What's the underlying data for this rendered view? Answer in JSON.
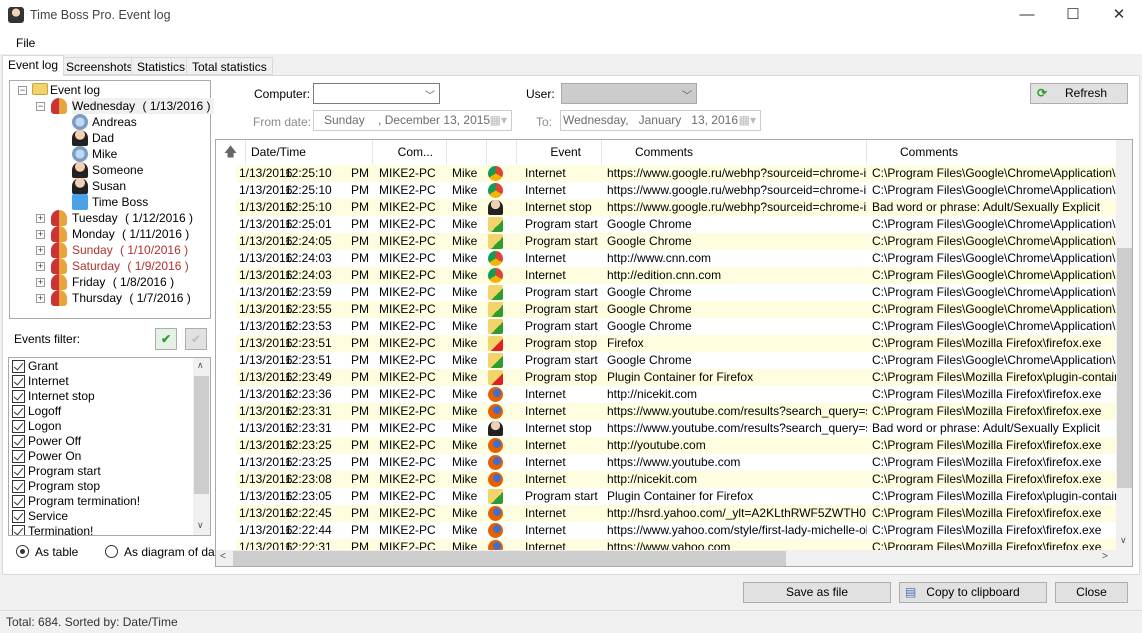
{
  "window": {
    "title": "Time Boss Pro. Event log",
    "minimize": "—",
    "maximize": "☐",
    "close": "✕"
  },
  "menu": {
    "file": "File"
  },
  "tabs": [
    {
      "label": "Event log",
      "active": true
    },
    {
      "label": "Screenshots"
    },
    {
      "label": "Statistics"
    },
    {
      "label": "Total statistics"
    }
  ],
  "tree": {
    "root": "Event log",
    "days": [
      {
        "day": "Wednesday",
        "date": "( 1/13/2016 )",
        "expanded": true,
        "weekend": false,
        "users": [
          {
            "name": "Andreas",
            "icon": "standard-user-icon"
          },
          {
            "name": "Dad",
            "icon": "admin-user-icon"
          },
          {
            "name": "Mike",
            "icon": "standard-user-icon"
          },
          {
            "name": "Someone",
            "icon": "admin-user-icon"
          },
          {
            "name": "Susan",
            "icon": "admin-user-icon"
          },
          {
            "name": "Time Boss",
            "icon": "computer-icon"
          }
        ]
      },
      {
        "day": "Tuesday",
        "date": "( 1/12/2016 )",
        "weekend": false
      },
      {
        "day": "Monday",
        "date": "( 1/11/2016 )",
        "weekend": false
      },
      {
        "day": "Sunday",
        "date": "( 1/10/2016 )",
        "weekend": true
      },
      {
        "day": "Saturday",
        "date": "( 1/9/2016 )",
        "weekend": true
      },
      {
        "day": "Friday",
        "date": "( 1/8/2016 )",
        "weekend": false
      },
      {
        "day": "Thursday",
        "date": "( 1/7/2016 )",
        "weekend": false
      }
    ]
  },
  "filter": {
    "label": "Events filter:",
    "items": [
      "Grant",
      "Internet",
      "Internet stop",
      "Logoff",
      "Logon",
      "Power Off",
      "Power On",
      "Program start",
      "Program stop",
      "Program termination!",
      "Service",
      "Termination!"
    ]
  },
  "view": {
    "as_table": "As table",
    "as_diagram": "As diagram of day",
    "selected": "as_table"
  },
  "controls": {
    "computer_label": "Computer:",
    "computer_value": "",
    "user_label": "User:",
    "user_value": "",
    "from_label": "From date:",
    "from_value": "Sunday    , December 13, 2015",
    "to_label": "To:",
    "to_value": "Wednesday,   January   13, 2016",
    "refresh": "Refresh"
  },
  "columns": [
    "Date/Time",
    "Com...",
    "",
    "",
    "Event",
    "Comments",
    "Comments"
  ],
  "rows": [
    {
      "date": "1/13/2016",
      "time": "12:25:10",
      "ampm": "PM",
      "computer": "MIKE2-PC",
      "user": "Mike",
      "icon": "chrome",
      "event": "Internet",
      "comment1": "https://www.google.ru/webhp?sourceid=chrome-in...",
      "comment2": "C:\\Program Files\\Google\\Chrome\\Application\\chrome.exe"
    },
    {
      "date": "1/13/2016",
      "time": "12:25:10",
      "ampm": "PM",
      "computer": "MIKE2-PC",
      "user": "Mike",
      "icon": "chrome",
      "event": "Internet",
      "comment1": "https://www.google.ru/webhp?sourceid=chrome-in...",
      "comment2": "C:\\Program Files\\Google\\Chrome\\Application\\chrome.exe"
    },
    {
      "date": "1/13/2016",
      "time": "12:25:10",
      "ampm": "PM",
      "computer": "MIKE2-PC",
      "user": "Mike",
      "icon": "person",
      "event": "Internet stop",
      "comment1": "https://www.google.ru/webhp?sourceid=chrome-in...",
      "comment2": "Bad word or phrase: Adult/Sexually Explicit"
    },
    {
      "date": "1/13/2016",
      "time": "12:25:01",
      "ampm": "PM",
      "computer": "MIKE2-PC",
      "user": "Mike",
      "icon": "program-start",
      "event": "Program start",
      "comment1": "Google Chrome",
      "comment2": "C:\\Program Files\\Google\\Chrome\\Application\\chrome.exe"
    },
    {
      "date": "1/13/2016",
      "time": "12:24:05",
      "ampm": "PM",
      "computer": "MIKE2-PC",
      "user": "Mike",
      "icon": "program-start",
      "event": "Program start",
      "comment1": "Google Chrome",
      "comment2": "C:\\Program Files\\Google\\Chrome\\Application\\chrome.exe"
    },
    {
      "date": "1/13/2016",
      "time": "12:24:03",
      "ampm": "PM",
      "computer": "MIKE2-PC",
      "user": "Mike",
      "icon": "chrome",
      "event": "Internet",
      "comment1": "http://www.cnn.com",
      "comment2": "C:\\Program Files\\Google\\Chrome\\Application\\chrome.exe"
    },
    {
      "date": "1/13/2016",
      "time": "12:24:03",
      "ampm": "PM",
      "computer": "MIKE2-PC",
      "user": "Mike",
      "icon": "chrome",
      "event": "Internet",
      "comment1": "http://edition.cnn.com",
      "comment2": "C:\\Program Files\\Google\\Chrome\\Application\\chrome.exe"
    },
    {
      "date": "1/13/2016",
      "time": "12:23:59",
      "ampm": "PM",
      "computer": "MIKE2-PC",
      "user": "Mike",
      "icon": "program-start",
      "event": "Program start",
      "comment1": "Google Chrome",
      "comment2": "C:\\Program Files\\Google\\Chrome\\Application\\chrome.exe"
    },
    {
      "date": "1/13/2016",
      "time": "12:23:55",
      "ampm": "PM",
      "computer": "MIKE2-PC",
      "user": "Mike",
      "icon": "program-start",
      "event": "Program start",
      "comment1": "Google Chrome",
      "comment2": "C:\\Program Files\\Google\\Chrome\\Application\\chrome.exe"
    },
    {
      "date": "1/13/2016",
      "time": "12:23:53",
      "ampm": "PM",
      "computer": "MIKE2-PC",
      "user": "Mike",
      "icon": "program-start",
      "event": "Program start",
      "comment1": "Google Chrome",
      "comment2": "C:\\Program Files\\Google\\Chrome\\Application\\chrome.exe"
    },
    {
      "date": "1/13/2016",
      "time": "12:23:51",
      "ampm": "PM",
      "computer": "MIKE2-PC",
      "user": "Mike",
      "icon": "program-stop",
      "event": "Program stop",
      "comment1": "Firefox",
      "comment2": "C:\\Program Files\\Mozilla Firefox\\firefox.exe"
    },
    {
      "date": "1/13/2016",
      "time": "12:23:51",
      "ampm": "PM",
      "computer": "MIKE2-PC",
      "user": "Mike",
      "icon": "program-start",
      "event": "Program start",
      "comment1": "Google Chrome",
      "comment2": "C:\\Program Files\\Google\\Chrome\\Application\\chrome.exe"
    },
    {
      "date": "1/13/2016",
      "time": "12:23:49",
      "ampm": "PM",
      "computer": "MIKE2-PC",
      "user": "Mike",
      "icon": "program-stop",
      "event": "Program stop",
      "comment1": "Plugin Container for Firefox",
      "comment2": "C:\\Program Files\\Mozilla Firefox\\plugin-container.exe"
    },
    {
      "date": "1/13/2016",
      "time": "12:23:36",
      "ampm": "PM",
      "computer": "MIKE2-PC",
      "user": "Mike",
      "icon": "firefox",
      "event": "Internet",
      "comment1": "http://nicekit.com",
      "comment2": "C:\\Program Files\\Mozilla Firefox\\firefox.exe"
    },
    {
      "date": "1/13/2016",
      "time": "12:23:31",
      "ampm": "PM",
      "computer": "MIKE2-PC",
      "user": "Mike",
      "icon": "firefox",
      "event": "Internet",
      "comment1": "https://www.youtube.com/results?search_query=sex",
      "comment2": "C:\\Program Files\\Mozilla Firefox\\firefox.exe"
    },
    {
      "date": "1/13/2016",
      "time": "12:23:31",
      "ampm": "PM",
      "computer": "MIKE2-PC",
      "user": "Mike",
      "icon": "person",
      "event": "Internet stop",
      "comment1": "https://www.youtube.com/results?search_query=sex",
      "comment2": "Bad word or phrase: Adult/Sexually Explicit"
    },
    {
      "date": "1/13/2016",
      "time": "12:23:25",
      "ampm": "PM",
      "computer": "MIKE2-PC",
      "user": "Mike",
      "icon": "firefox",
      "event": "Internet",
      "comment1": "http://youtube.com",
      "comment2": "C:\\Program Files\\Mozilla Firefox\\firefox.exe"
    },
    {
      "date": "1/13/2016",
      "time": "12:23:25",
      "ampm": "PM",
      "computer": "MIKE2-PC",
      "user": "Mike",
      "icon": "firefox",
      "event": "Internet",
      "comment1": "https://www.youtube.com",
      "comment2": "C:\\Program Files\\Mozilla Firefox\\firefox.exe"
    },
    {
      "date": "1/13/2016",
      "time": "12:23:08",
      "ampm": "PM",
      "computer": "MIKE2-PC",
      "user": "Mike",
      "icon": "firefox",
      "event": "Internet",
      "comment1": "http://nicekit.com",
      "comment2": "C:\\Program Files\\Mozilla Firefox\\firefox.exe"
    },
    {
      "date": "1/13/2016",
      "time": "12:23:05",
      "ampm": "PM",
      "computer": "MIKE2-PC",
      "user": "Mike",
      "icon": "program-start",
      "event": "Program start",
      "comment1": "Plugin Container for Firefox",
      "comment2": "C:\\Program Files\\Mozilla Firefox\\plugin-container.exe"
    },
    {
      "date": "1/13/2016",
      "time": "12:22:45",
      "ampm": "PM",
      "computer": "MIKE2-PC",
      "user": "Mike",
      "icon": "firefox",
      "event": "Internet",
      "comment1": "http://hsrd.yahoo.com/_ylt=A2KLthRWF5ZWTH0...",
      "comment2": "C:\\Program Files\\Mozilla Firefox\\firefox.exe"
    },
    {
      "date": "1/13/2016",
      "time": "12:22:44",
      "ampm": "PM",
      "computer": "MIKE2-PC",
      "user": "Mike",
      "icon": "firefox",
      "event": "Internet",
      "comment1": "https://www.yahoo.com/style/first-lady-michelle-ob...",
      "comment2": "C:\\Program Files\\Mozilla Firefox\\firefox.exe"
    },
    {
      "date": "1/13/2016",
      "time": "12:22:31",
      "ampm": "PM",
      "computer": "MIKE2-PC",
      "user": "Mike",
      "icon": "firefox",
      "event": "Internet",
      "comment1": "https://www.yahoo.com",
      "comment2": "C:\\Program Files\\Mozilla Firefox\\firefox.exe"
    }
  ],
  "buttons": {
    "save": "Save as file",
    "copy": "Copy to clipboard",
    "close": "Close"
  },
  "status": "Total: 684.  Sorted by: Date/Time",
  "colors": {
    "alt_row": "#fefde0",
    "weekend": "#b03030",
    "accent_green": "#2e9c2e"
  }
}
